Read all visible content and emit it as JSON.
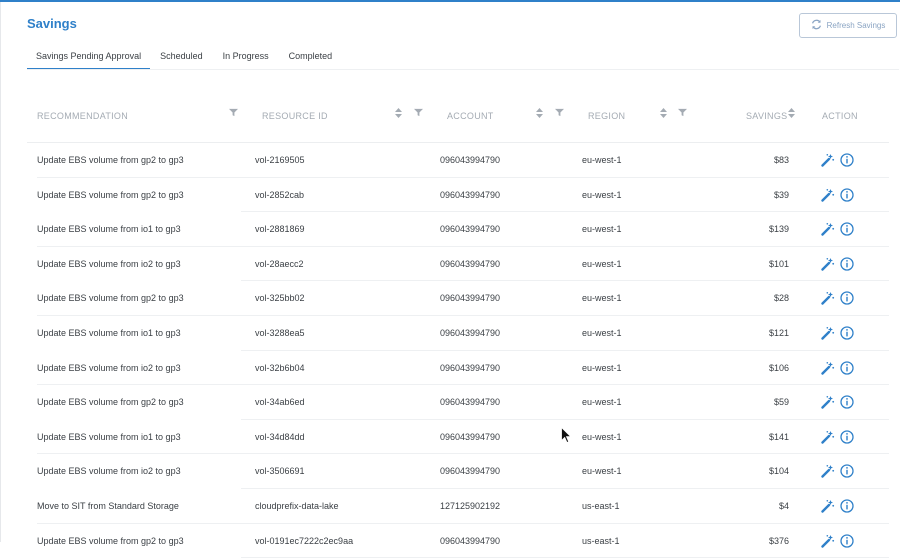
{
  "header": {
    "title": "Savings",
    "refresh_label": "Refresh Savings"
  },
  "tabs": [
    {
      "label": "Savings Pending Approval"
    },
    {
      "label": "Scheduled"
    },
    {
      "label": "In Progress"
    },
    {
      "label": "Completed"
    }
  ],
  "columns": {
    "recommendation": "RECOMMENDATION",
    "resource_id": "RESOURCE ID",
    "account": "ACCOUNT",
    "region": "REGION",
    "savings": "SAVINGS",
    "action": "ACTION"
  },
  "rows": [
    {
      "recommendation": "Update EBS volume from gp2 to gp3",
      "resource_id": "vol-2169505",
      "account": "096043994790",
      "region": "eu-west-1",
      "savings": "$83"
    },
    {
      "recommendation": "Update EBS volume from gp2 to gp3",
      "resource_id": "vol-2852cab",
      "account": "096043994790",
      "region": "eu-west-1",
      "savings": "$39"
    },
    {
      "recommendation": "Update EBS volume from io1 to gp3",
      "resource_id": "vol-2881869",
      "account": "096043994790",
      "region": "eu-west-1",
      "savings": "$139"
    },
    {
      "recommendation": "Update EBS volume from io2 to gp3",
      "resource_id": "vol-28aecc2",
      "account": "096043994790",
      "region": "eu-west-1",
      "savings": "$101"
    },
    {
      "recommendation": "Update EBS volume from gp2 to gp3",
      "resource_id": "vol-325bb02",
      "account": "096043994790",
      "region": "eu-west-1",
      "savings": "$28"
    },
    {
      "recommendation": "Update EBS volume from io1 to gp3",
      "resource_id": "vol-3288ea5",
      "account": "096043994790",
      "region": "eu-west-1",
      "savings": "$121"
    },
    {
      "recommendation": "Update EBS volume from io2 to gp3",
      "resource_id": "vol-32b6b04",
      "account": "096043994790",
      "region": "eu-west-1",
      "savings": "$106"
    },
    {
      "recommendation": "Update EBS volume from gp2 to gp3",
      "resource_id": "vol-34ab6ed",
      "account": "096043994790",
      "region": "eu-west-1",
      "savings": "$59"
    },
    {
      "recommendation": "Update EBS volume from io1 to gp3",
      "resource_id": "vol-34d84dd",
      "account": "096043994790",
      "region": "eu-west-1",
      "savings": "$141"
    },
    {
      "recommendation": "Update EBS volume from io2 to gp3",
      "resource_id": "vol-3506691",
      "account": "096043994790",
      "region": "eu-west-1",
      "savings": "$104"
    },
    {
      "recommendation": "Move to SIT from Standard Storage",
      "resource_id": "cloudprefix-data-lake",
      "account": "127125902192",
      "region": "us-east-1",
      "savings": "$4"
    },
    {
      "recommendation": "Update EBS volume from gp2 to gp3",
      "resource_id": "vol-0191ec7222c2ec9aa",
      "account": "096043994790",
      "region": "us-east-1",
      "savings": "$376"
    }
  ],
  "icons": {
    "refresh": "refresh-icon",
    "sort": "sort-icon",
    "filter": "filter-icon",
    "apply": "magic-wand-icon",
    "info": "info-icon"
  },
  "colors": {
    "accent": "#2f80c9",
    "header_text": "#a4abb3"
  }
}
